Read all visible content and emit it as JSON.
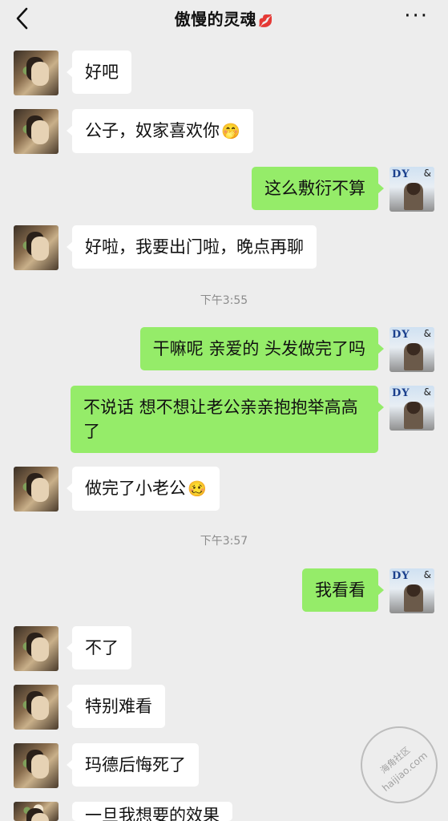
{
  "header": {
    "title": "傲慢的灵魂",
    "title_emoji": "💋",
    "more": "···"
  },
  "messages": [
    {
      "from": "her",
      "text": "好吧"
    },
    {
      "from": "her",
      "text": "公子，奴家喜欢你",
      "emoji": "🤭"
    },
    {
      "from": "me",
      "text": "这么敷衍不算"
    },
    {
      "from": "her",
      "text": "好啦，我要出门啦，晚点再聊"
    },
    {
      "type": "time",
      "text": "下午3:55"
    },
    {
      "from": "me",
      "text": "干嘛呢 亲爱的 头发做完了吗"
    },
    {
      "from": "me",
      "text": "不说话 想不想让老公亲亲抱抱举高高了"
    },
    {
      "from": "her",
      "text": "做完了小老公",
      "emoji": "🥴"
    },
    {
      "type": "time",
      "text": "下午3:57"
    },
    {
      "from": "me",
      "text": "我看看"
    },
    {
      "from": "her",
      "text": "不了"
    },
    {
      "from": "her",
      "text": "特别难看"
    },
    {
      "from": "her",
      "text": "玛德后悔死了"
    },
    {
      "from": "her",
      "text": "一旦我想要的效果"
    }
  ],
  "avatars": {
    "me_text_left": "DY",
    "me_text_right": "&"
  },
  "watermark": {
    "line1": "海角社区",
    "line2": "haijiao.com"
  }
}
